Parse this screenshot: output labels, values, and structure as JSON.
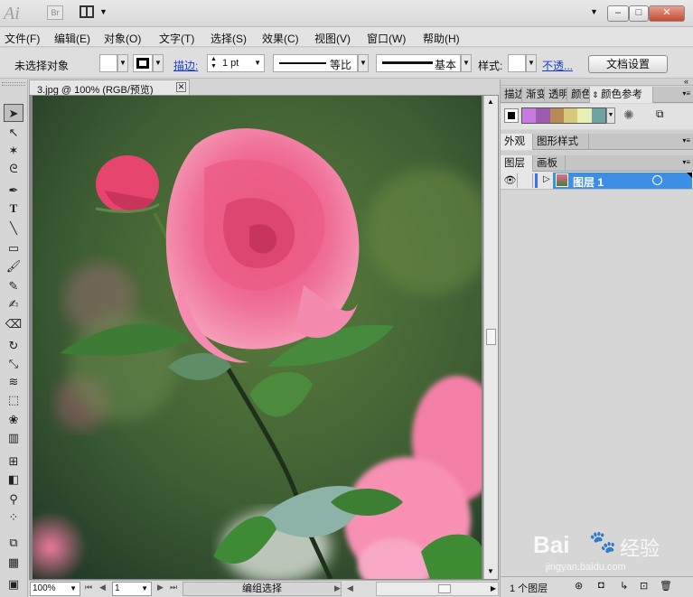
{
  "app": {
    "logo": "Ai",
    "bridge_label": "Br",
    "window_buttons": [
      "–",
      "□",
      "✕"
    ]
  },
  "menu": [
    "文件(F)",
    "编辑(E)",
    "对象(O)",
    "文字(T)",
    "选择(S)",
    "效果(C)",
    "视图(V)",
    "窗口(W)",
    "帮助(H)"
  ],
  "control_bar": {
    "selection_status": "未选择对象",
    "stroke_label": "描边:",
    "stroke_weight": "1 pt",
    "stroke_profile": "等比",
    "brush": "基本",
    "style_label": "样式:",
    "opacity_link": "不透...",
    "doc_settings_button": "文档设置"
  },
  "document": {
    "tab_title": "3.jpg @ 100% (RGB/预览)",
    "close_glyph": "✕"
  },
  "status_bar": {
    "zoom": "100%",
    "artboard": "1",
    "selection_mode": "编组选择"
  },
  "panels": {
    "top_tabs": [
      "描边",
      "渐变",
      "透明",
      "颜色",
      "颜色参考"
    ],
    "guide_colors": [
      "#c77ae0",
      "#9b5bb0",
      "#b78a54",
      "#d7c87a",
      "#e6efb4",
      "#6fa3a3"
    ],
    "appearance_tabs": [
      "外观",
      "图形样式"
    ],
    "layers_tabs": [
      "图层",
      "画板"
    ],
    "layer_name": "图层 1",
    "layer_count": "1 个图层"
  },
  "watermark": {
    "brand": "Bai",
    "brand2": "经验",
    "url": "jingyan.baidu.com"
  },
  "colors": {
    "layer_highlight": "#3d8fe6",
    "link": "#1a3ec9"
  }
}
